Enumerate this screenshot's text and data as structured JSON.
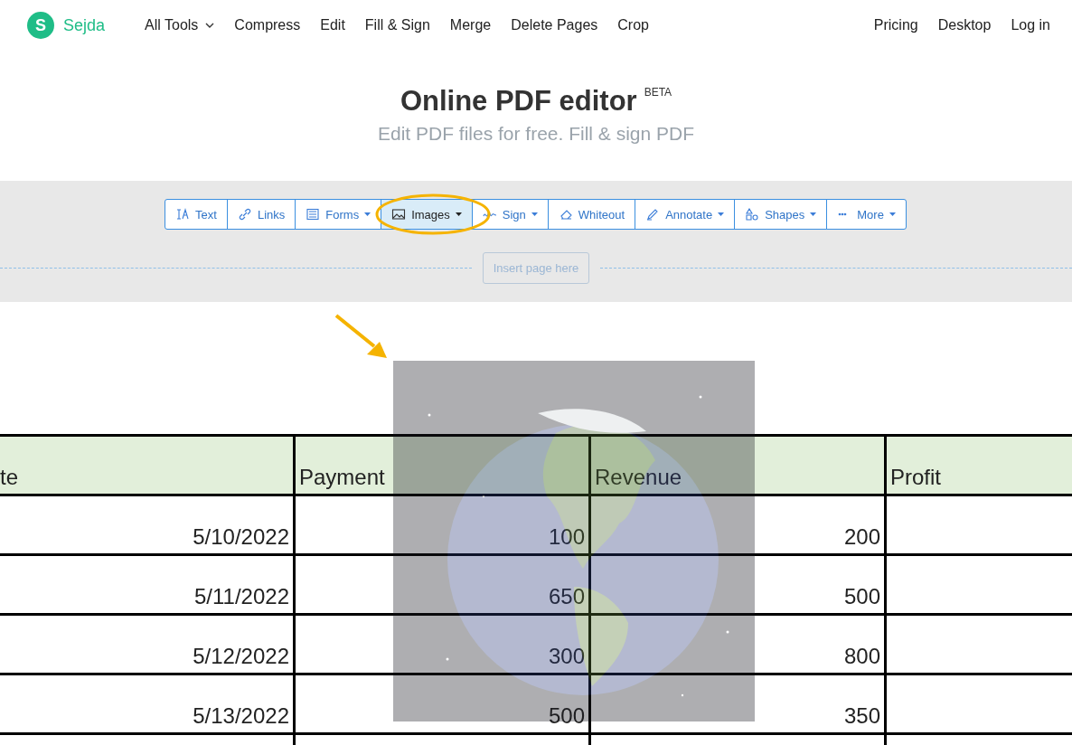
{
  "nav": {
    "brand": "Sejda",
    "logo_letter": "S",
    "links": [
      {
        "label": "All Tools",
        "dropdown": true
      },
      {
        "label": "Compress",
        "dropdown": false
      },
      {
        "label": "Edit",
        "dropdown": false
      },
      {
        "label": "Fill & Sign",
        "dropdown": false
      },
      {
        "label": "Merge",
        "dropdown": false
      },
      {
        "label": "Delete Pages",
        "dropdown": false
      },
      {
        "label": "Crop",
        "dropdown": false
      }
    ],
    "right_links": [
      "Pricing",
      "Desktop",
      "Log in"
    ]
  },
  "hero": {
    "title": "Online PDF editor",
    "badge": "BETA",
    "subtitle": "Edit PDF files for free. Fill & sign PDF"
  },
  "toolbar": [
    {
      "label": "Text",
      "dropdown": false,
      "selected": false
    },
    {
      "label": "Links",
      "dropdown": false,
      "selected": false
    },
    {
      "label": "Forms",
      "dropdown": true,
      "selected": false
    },
    {
      "label": "Images",
      "dropdown": true,
      "selected": true
    },
    {
      "label": "Sign",
      "dropdown": true,
      "selected": false
    },
    {
      "label": "Whiteout",
      "dropdown": false,
      "selected": false
    },
    {
      "label": "Annotate",
      "dropdown": true,
      "selected": false
    },
    {
      "label": "Shapes",
      "dropdown": true,
      "selected": false
    },
    {
      "label": "More",
      "dropdown": true,
      "selected": false
    }
  ],
  "insert_button": {
    "label": "Insert page here",
    "disabled": true
  },
  "table": {
    "columns": [
      "te",
      "Payment",
      "Revenue",
      "Profit"
    ],
    "rows": [
      [
        "5/10/2022",
        "100",
        "200",
        ""
      ],
      [
        "5/11/2022",
        "650",
        "500",
        ""
      ],
      [
        "5/12/2022",
        "300",
        "800",
        ""
      ],
      [
        "5/13/2022",
        "500",
        "350",
        ""
      ],
      [
        "",
        "",
        "",
        ""
      ]
    ]
  }
}
